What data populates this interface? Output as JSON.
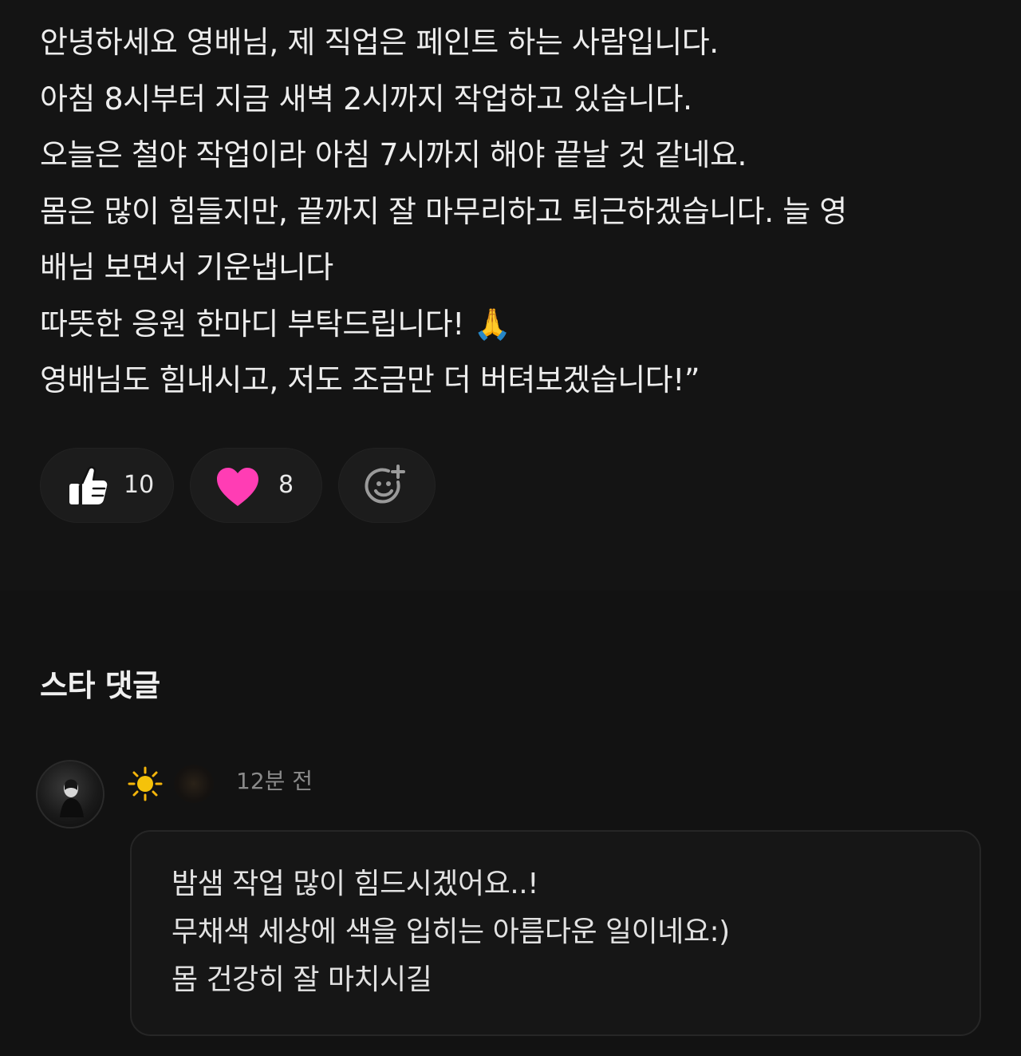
{
  "post": {
    "lines": [
      "안녕하세요 영배님, 제 직업은 페인트 하는 사람입니다.",
      "아침 8시부터 지금 새벽 2시까지 작업하고 있습니다.",
      "오늘은 철야 작업이라 아침 7시까지 해야 끝날 것 같네요.",
      "몸은 많이 힘들지만, 끝까지 잘 마무리하고 퇴근하겠습니다. 늘 영",
      "배님 보면서 기운냅니다",
      "따뜻한 응원 한마디 부탁드립니다! 🙏",
      "영배님도 힘내시고, 저도 조금만 더 버텨보겠습니다!”"
    ]
  },
  "reactions": {
    "like": {
      "icon": "thumbs-up-icon",
      "count": "10"
    },
    "heart": {
      "icon": "heart-icon",
      "count": "8",
      "color": "#ff3db4"
    },
    "add": {
      "icon": "add-reaction-icon"
    }
  },
  "comments": {
    "title": "스타 댓글",
    "items": [
      {
        "avatar_icon": "avatar",
        "badge_icon": "sun-icon",
        "time": "12분 전",
        "lines": [
          "밤샘 작업 많이 힘드시겠어요..!",
          "무채색 세상에 색을 입히는 아름다운 일이네요:)",
          "몸 건강히 잘 마치시길"
        ]
      }
    ]
  },
  "colors": {
    "post_background": "#141414",
    "comments_background": "#121212",
    "text": "#ededed",
    "muted_text": "#8a8a8a",
    "heart": "#ff3db4",
    "sun": "#f5b50a"
  }
}
